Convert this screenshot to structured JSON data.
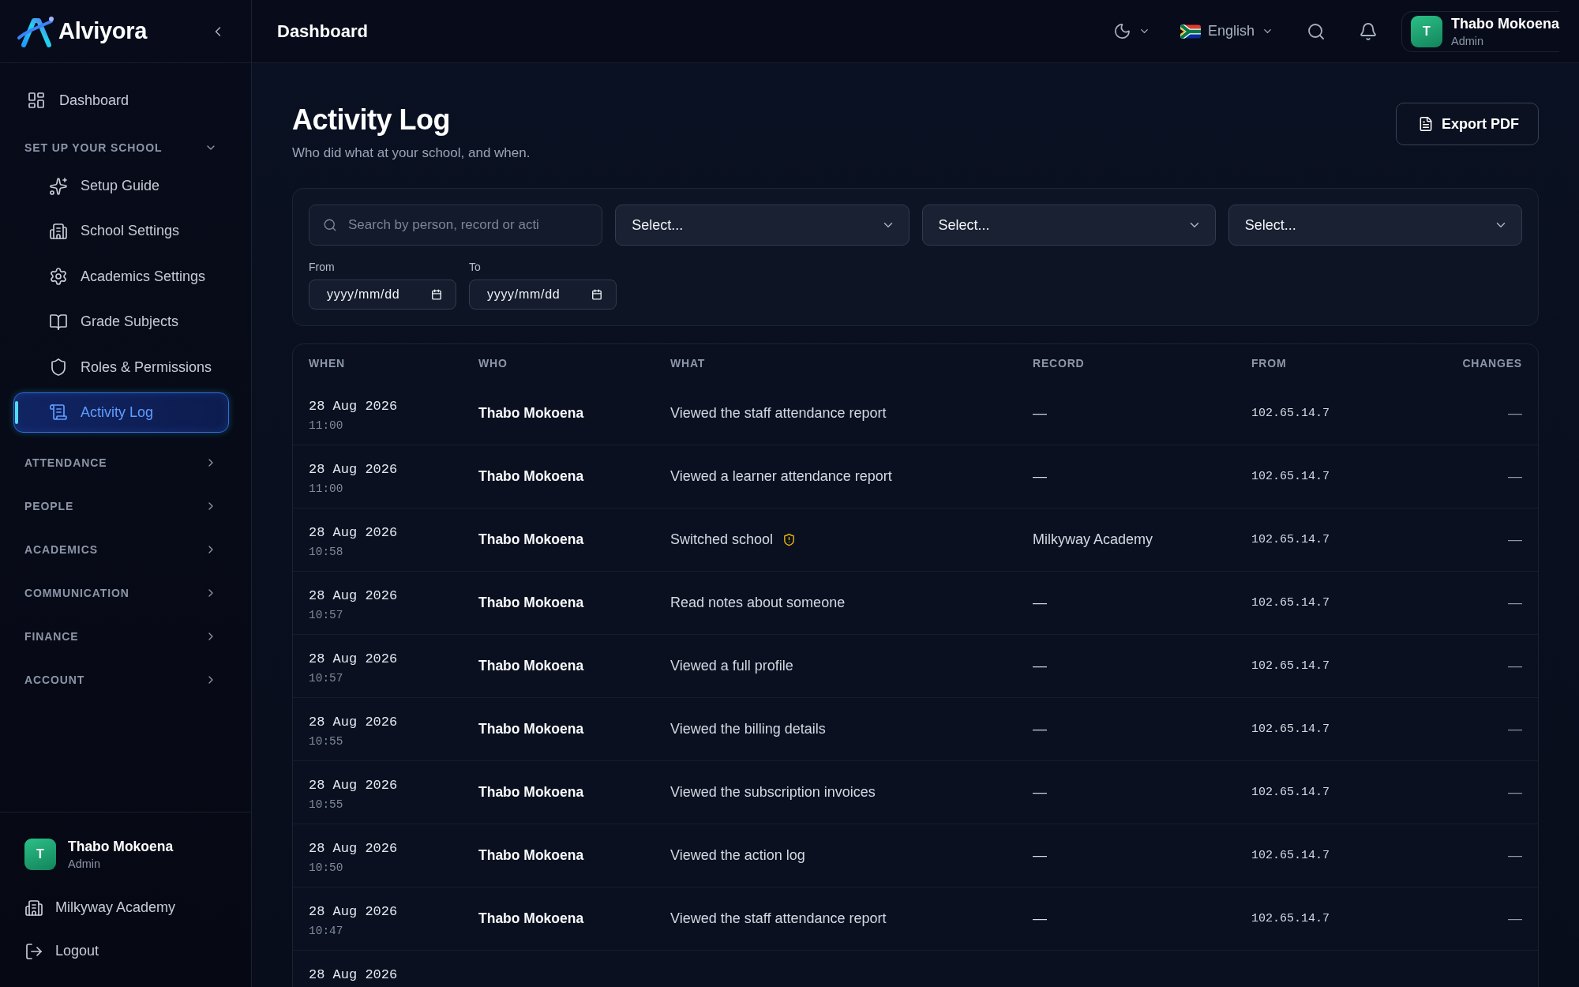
{
  "sidebar": {
    "logo": "Alviyora",
    "nav": [
      {
        "kind": "link",
        "label": "Dashboard",
        "selected": false
      },
      {
        "kind": "section",
        "label": "SET UP YOUR SCHOOL",
        "expanded": true,
        "children": [
          {
            "label": "Setup Guide",
            "selected": false
          },
          {
            "label": "School Settings",
            "selected": false
          },
          {
            "label": "Academics Settings",
            "selected": false
          },
          {
            "label": "Grade Subjects",
            "selected": false
          },
          {
            "label": "Roles & Permissions",
            "selected": false
          },
          {
            "label": "Activity Log",
            "selected": true
          }
        ]
      },
      {
        "kind": "section",
        "label": "ATTENDANCE",
        "expanded": false
      },
      {
        "kind": "section",
        "label": "PEOPLE",
        "expanded": false
      },
      {
        "kind": "section",
        "label": "ACADEMICS",
        "expanded": false
      },
      {
        "kind": "section",
        "label": "COMMUNICATION",
        "expanded": false
      },
      {
        "kind": "section",
        "label": "FINANCE",
        "expanded": false
      },
      {
        "kind": "section",
        "label": "ACCOUNT",
        "expanded": false
      }
    ],
    "user": {
      "initial": "T",
      "name": "Thabo Mokoena",
      "role": "Admin"
    },
    "links": [
      "Milkyway Academy",
      "Logout"
    ]
  },
  "topbar": {
    "title": "Dashboard",
    "language": "English",
    "user": {
      "initial": "T",
      "name": "Thabo Mokoena",
      "role": "Admin"
    }
  },
  "page": {
    "title": "Activity Log",
    "subtitle": "Who did what at your school, and when.",
    "export_button": "Export PDF"
  },
  "filters": {
    "search": {
      "placeholder": "Search by person, record or acti"
    },
    "selects": [
      {
        "placeholder": "Select..."
      },
      {
        "placeholder": "Select..."
      },
      {
        "placeholder": "Select..."
      }
    ],
    "dates": [
      {
        "label": "From",
        "placeholder": "yyyy/mm/dd"
      },
      {
        "label": "To",
        "placeholder": "yyyy/mm/dd"
      }
    ]
  },
  "table": {
    "columns": [
      "WHEN",
      "WHO",
      "WHAT",
      "RECORD",
      "FROM",
      "CHANGES"
    ],
    "rows": [
      {
        "date": "28 Aug 2026",
        "time": "11:00",
        "who": "Thabo Mokoena",
        "what": "Viewed the staff attendance report",
        "flagged": false,
        "record": "—",
        "from": "102.65.14.7",
        "changes": "—"
      },
      {
        "date": "28 Aug 2026",
        "time": "11:00",
        "who": "Thabo Mokoena",
        "what": "Viewed a learner attendance report",
        "flagged": false,
        "record": "—",
        "from": "102.65.14.7",
        "changes": "—"
      },
      {
        "date": "28 Aug 2026",
        "time": "10:58",
        "who": "Thabo Mokoena",
        "what": "Switched school",
        "flagged": true,
        "record": "Milkyway Academy",
        "from": "102.65.14.7",
        "changes": "—"
      },
      {
        "date": "28 Aug 2026",
        "time": "10:57",
        "who": "Thabo Mokoena",
        "what": "Read notes about someone",
        "flagged": false,
        "record": "—",
        "from": "102.65.14.7",
        "changes": "—"
      },
      {
        "date": "28 Aug 2026",
        "time": "10:57",
        "who": "Thabo Mokoena",
        "what": "Viewed a full profile",
        "flagged": false,
        "record": "—",
        "from": "102.65.14.7",
        "changes": "—"
      },
      {
        "date": "28 Aug 2026",
        "time": "10:55",
        "who": "Thabo Mokoena",
        "what": "Viewed the billing details",
        "flagged": false,
        "record": "—",
        "from": "102.65.14.7",
        "changes": "—"
      },
      {
        "date": "28 Aug 2026",
        "time": "10:55",
        "who": "Thabo Mokoena",
        "what": "Viewed the subscription invoices",
        "flagged": false,
        "record": "—",
        "from": "102.65.14.7",
        "changes": "—"
      },
      {
        "date": "28 Aug 2026",
        "time": "10:50",
        "who": "Thabo Mokoena",
        "what": "Viewed the action log",
        "flagged": false,
        "record": "—",
        "from": "102.65.14.7",
        "changes": "—"
      },
      {
        "date": "28 Aug 2026",
        "time": "10:47",
        "who": "Thabo Mokoena",
        "what": "Viewed the staff attendance report",
        "flagged": false,
        "record": "—",
        "from": "102.65.14.7",
        "changes": "—"
      },
      {
        "date": "28 Aug 2026"
      }
    ]
  }
}
